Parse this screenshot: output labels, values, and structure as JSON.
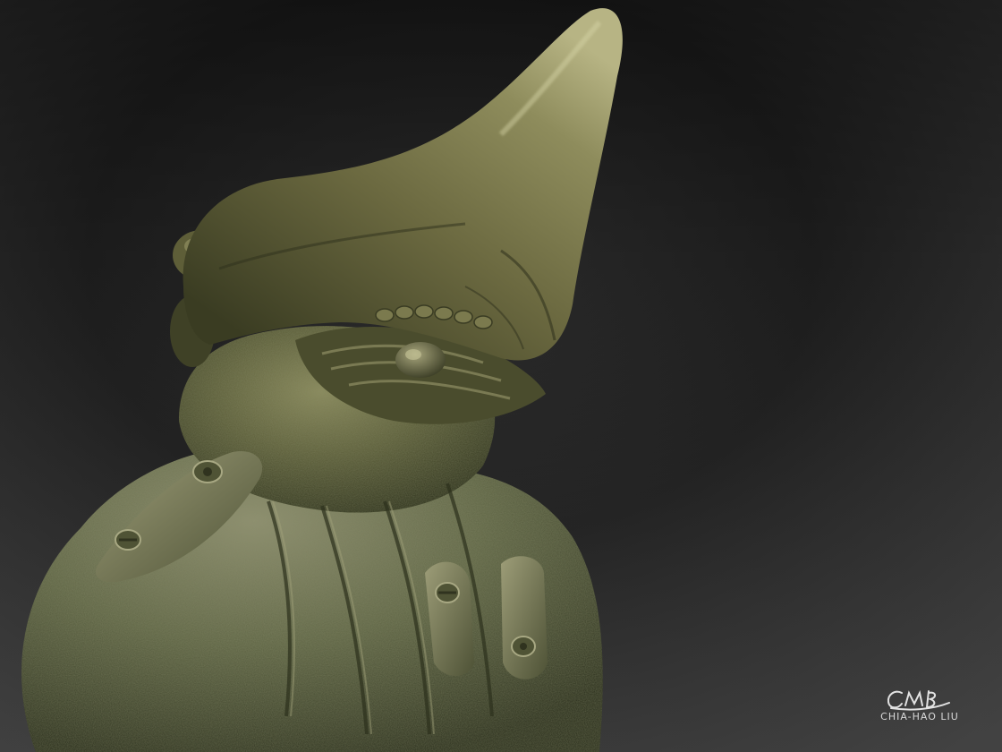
{
  "artwork": {
    "subject_icon": "alien-creature-bust-sculpture",
    "background_color": "#1f1f1f",
    "palette": {
      "skin_dark": "#3b4226",
      "skin_mid": "#6b6a3f",
      "skin_light": "#9a9a66",
      "highlight": "#c8c79a"
    }
  },
  "signature": {
    "monogram_icon": "cmb-monogram-signature",
    "artist_name": "CHIA-HAO LIU"
  }
}
